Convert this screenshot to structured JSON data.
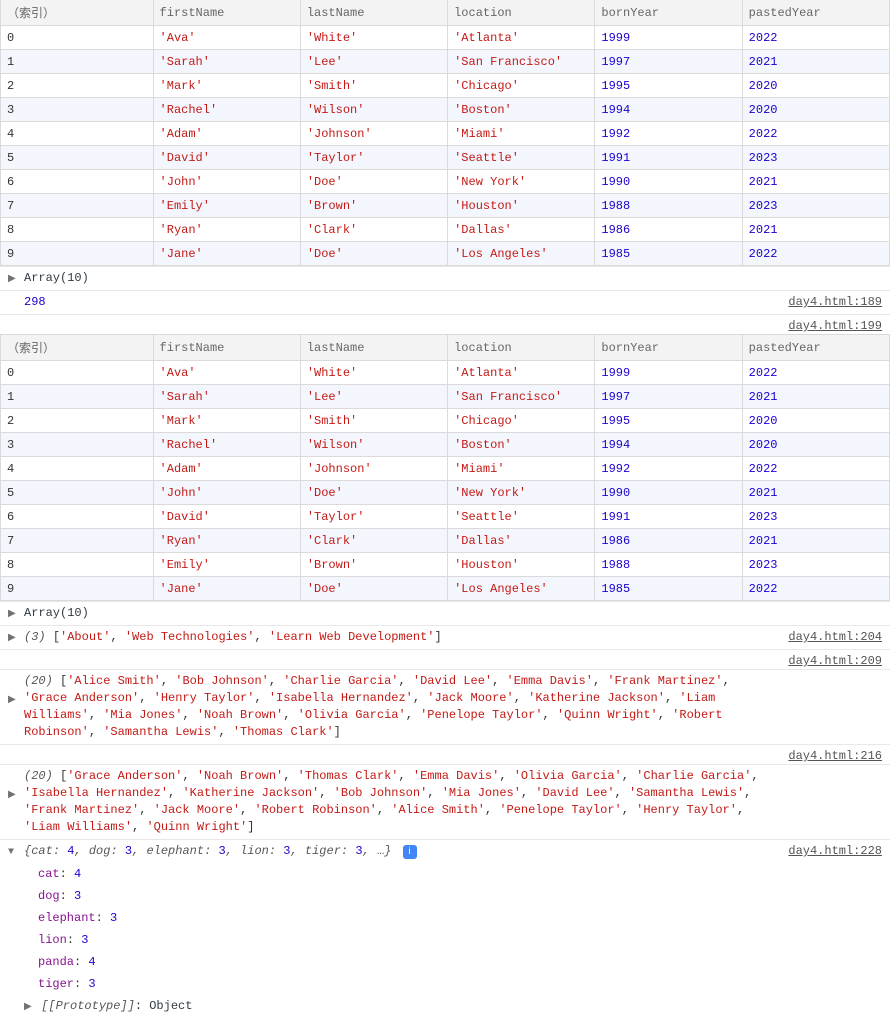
{
  "headers": {
    "index": "（索引）",
    "firstName": "firstName",
    "lastName": "lastName",
    "location": "location",
    "bornYear": "bornYear",
    "pastedYear": "pastedYear"
  },
  "table1": [
    {
      "i": "0",
      "fn": "'Ava'",
      "ln": "'White'",
      "loc": "'Atlanta'",
      "by": "1999",
      "py": "2022"
    },
    {
      "i": "1",
      "fn": "'Sarah'",
      "ln": "'Lee'",
      "loc": "'San Francisco'",
      "by": "1997",
      "py": "2021"
    },
    {
      "i": "2",
      "fn": "'Mark'",
      "ln": "'Smith'",
      "loc": "'Chicago'",
      "by": "1995",
      "py": "2020"
    },
    {
      "i": "3",
      "fn": "'Rachel'",
      "ln": "'Wilson'",
      "loc": "'Boston'",
      "by": "1994",
      "py": "2020"
    },
    {
      "i": "4",
      "fn": "'Adam'",
      "ln": "'Johnson'",
      "loc": "'Miami'",
      "by": "1992",
      "py": "2022"
    },
    {
      "i": "5",
      "fn": "'David'",
      "ln": "'Taylor'",
      "loc": "'Seattle'",
      "by": "1991",
      "py": "2023"
    },
    {
      "i": "6",
      "fn": "'John'",
      "ln": "'Doe'",
      "loc": "'New York'",
      "by": "1990",
      "py": "2021"
    },
    {
      "i": "7",
      "fn": "'Emily'",
      "ln": "'Brown'",
      "loc": "'Houston'",
      "by": "1988",
      "py": "2023"
    },
    {
      "i": "8",
      "fn": "'Ryan'",
      "ln": "'Clark'",
      "loc": "'Dallas'",
      "by": "1986",
      "py": "2021"
    },
    {
      "i": "9",
      "fn": "'Jane'",
      "ln": "'Doe'",
      "loc": "'Los Angeles'",
      "by": "1985",
      "py": "2022"
    }
  ],
  "table2": [
    {
      "i": "0",
      "fn": "'Ava'",
      "ln": "'White'",
      "loc": "'Atlanta'",
      "by": "1999",
      "py": "2022"
    },
    {
      "i": "1",
      "fn": "'Sarah'",
      "ln": "'Lee'",
      "loc": "'San Francisco'",
      "by": "1997",
      "py": "2021"
    },
    {
      "i": "2",
      "fn": "'Mark'",
      "ln": "'Smith'",
      "loc": "'Chicago'",
      "by": "1995",
      "py": "2020"
    },
    {
      "i": "3",
      "fn": "'Rachel'",
      "ln": "'Wilson'",
      "loc": "'Boston'",
      "by": "1994",
      "py": "2020"
    },
    {
      "i": "4",
      "fn": "'Adam'",
      "ln": "'Johnson'",
      "loc": "'Miami'",
      "by": "1992",
      "py": "2022"
    },
    {
      "i": "5",
      "fn": "'John'",
      "ln": "'Doe'",
      "loc": "'New York'",
      "by": "1990",
      "py": "2021"
    },
    {
      "i": "6",
      "fn": "'David'",
      "ln": "'Taylor'",
      "loc": "'Seattle'",
      "by": "1991",
      "py": "2023"
    },
    {
      "i": "7",
      "fn": "'Ryan'",
      "ln": "'Clark'",
      "loc": "'Dallas'",
      "by": "1986",
      "py": "2021"
    },
    {
      "i": "8",
      "fn": "'Emily'",
      "ln": "'Brown'",
      "loc": "'Houston'",
      "by": "1988",
      "py": "2023"
    },
    {
      "i": "9",
      "fn": "'Jane'",
      "ln": "'Doe'",
      "loc": "'Los Angeles'",
      "by": "1985",
      "py": "2022"
    }
  ],
  "arraySummary": "Array(10)",
  "sumValue": "298",
  "src189": "day4.html:189",
  "src199": "day4.html:199",
  "src204": "day4.html:204",
  "src209": "day4.html:209",
  "src216": "day4.html:216",
  "src228": "day4.html:228",
  "arr3": {
    "prefix": "(3) ",
    "items": [
      "'About'",
      "'Web Technologies'",
      "'Learn Web Development'"
    ]
  },
  "arr20a": {
    "prefix": "(20) ",
    "items": [
      "'Alice Smith'",
      "'Bob Johnson'",
      "'Charlie Garcia'",
      "'David Lee'",
      "'Emma Davis'",
      "'Frank Martinez'",
      "'Grace Anderson'",
      "'Henry Taylor'",
      "'Isabella Hernandez'",
      "'Jack Moore'",
      "'Katherine Jackson'",
      "'Liam Williams'",
      "'Mia Jones'",
      "'Noah Brown'",
      "'Olivia Garcia'",
      "'Penelope Taylor'",
      "'Quinn Wright'",
      "'Robert Robinson'",
      "'Samantha Lewis'",
      "'Thomas Clark'"
    ]
  },
  "arr20b": {
    "prefix": "(20) ",
    "items": [
      "'Grace Anderson'",
      "'Noah Brown'",
      "'Thomas Clark'",
      "'Emma Davis'",
      "'Olivia Garcia'",
      "'Charlie Garcia'",
      "'Isabella Hernandez'",
      "'Katherine Jackson'",
      "'Bob Johnson'",
      "'Mia Jones'",
      "'David Lee'",
      "'Samantha Lewis'",
      "'Frank Martinez'",
      "'Jack Moore'",
      "'Robert Robinson'",
      "'Alice Smith'",
      "'Penelope Taylor'",
      "'Henry Taylor'",
      "'Liam Williams'",
      "'Quinn Wright'"
    ]
  },
  "objSummary": {
    "preview": "{cat: 4, dog: 3, elephant: 3, lion: 3, tiger: 3, …}",
    "entries": [
      {
        "k": "cat",
        "v": "4"
      },
      {
        "k": "dog",
        "v": "3"
      },
      {
        "k": "elephant",
        "v": "3"
      },
      {
        "k": "lion",
        "v": "3"
      },
      {
        "k": "panda",
        "v": "4"
      },
      {
        "k": "tiger",
        "v": "3"
      }
    ],
    "proto": "[[Prototype]]",
    "protoVal": "Object"
  },
  "infoIcon": "i"
}
